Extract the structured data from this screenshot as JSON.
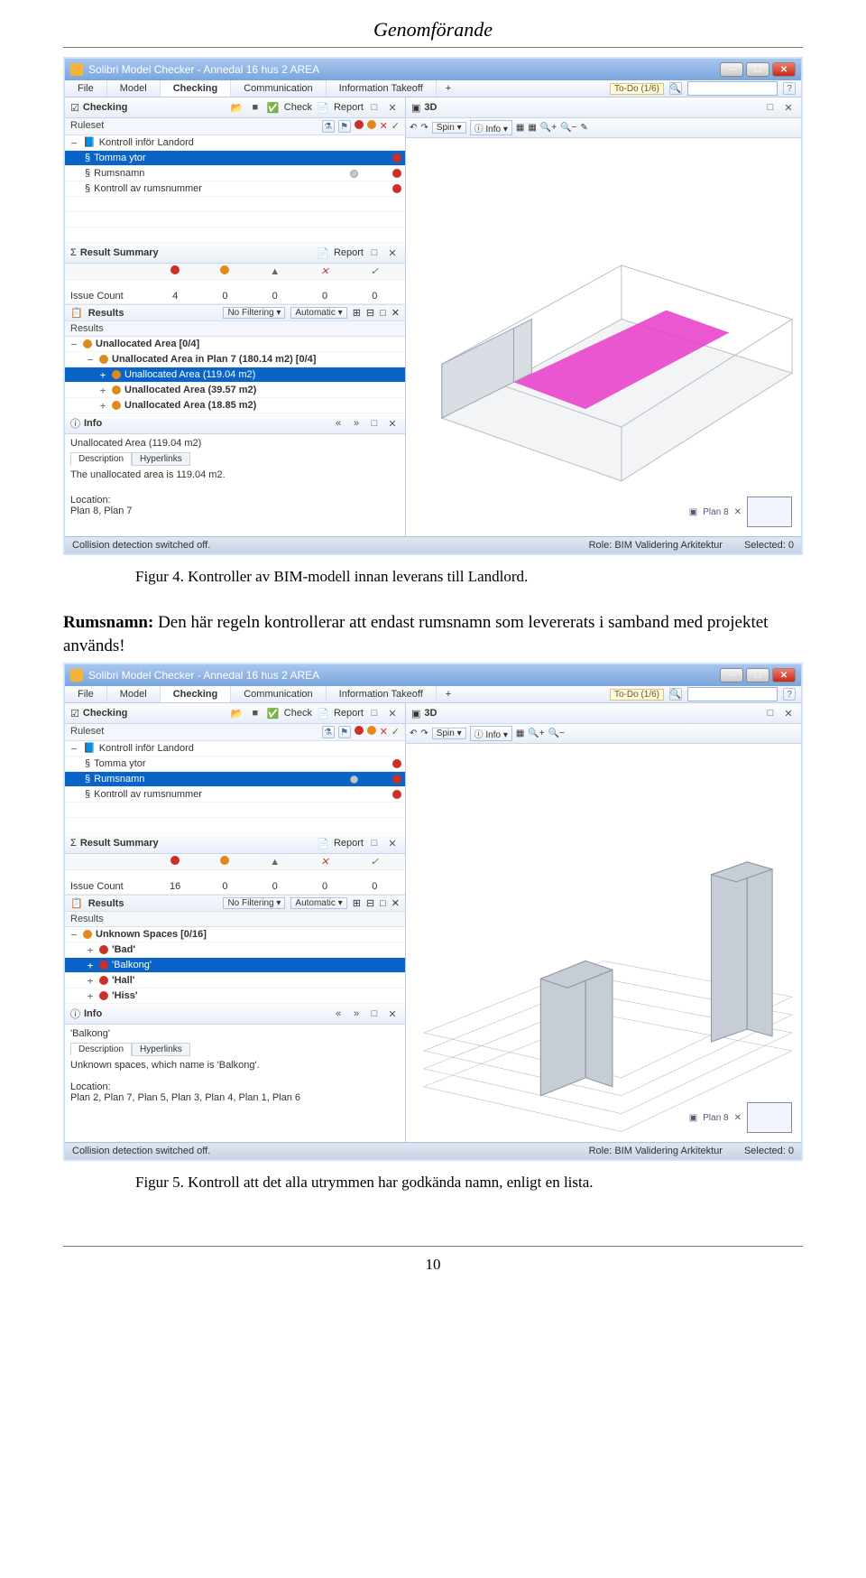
{
  "header": "Genomförande",
  "screenshot1": {
    "window_title": "Solibri Model Checker - Annedal 16 hus 2 AREA",
    "menus": [
      "File",
      "Model",
      "Checking",
      "Communication",
      "Information Takeoff"
    ],
    "active_menu": "Checking",
    "todo": "To-Do (1/6)",
    "checking_panel_title": "Checking",
    "check_btn": "Check",
    "report_btn": "Report",
    "ruleset_label": "Ruleset",
    "ruleset_root": "Kontroll inför Landord",
    "rules": [
      {
        "name": "Tomma ytor",
        "sev": "red",
        "selected": true
      },
      {
        "name": "Rumsnamn",
        "sev": "red",
        "selected": false,
        "extra": "grey"
      },
      {
        "name": "Kontroll av rumsnummer",
        "sev": "red",
        "selected": false
      }
    ],
    "summary_title": "Result Summary",
    "summary_report_btn": "Report",
    "issue_count_label": "Issue Count",
    "summary_counts": [
      "4",
      "0",
      "0",
      "0",
      "0"
    ],
    "results_title": "Results",
    "no_filtering": "No Filtering",
    "automatic": "Automatic",
    "results_label": "Results",
    "results_tree": [
      {
        "text": "Unallocated Area [0/4]",
        "sev": "orange",
        "bold": true,
        "indent": 0,
        "exp": "−"
      },
      {
        "text": "Unallocated Area in Plan 7 (180.14 m2) [0/4]",
        "sev": "orange",
        "bold": true,
        "indent": 1,
        "exp": "−"
      },
      {
        "text": "Unallocated Area (119.04 m2)",
        "sev": "orange",
        "indent": 2,
        "exp": "+",
        "selected": true
      },
      {
        "text": "Unallocated Area (39.57 m2)",
        "sev": "orange",
        "indent": 2,
        "exp": "+",
        "bold": true
      },
      {
        "text": "Unallocated Area (18.85 m2)",
        "sev": "orange",
        "indent": 2,
        "exp": "+",
        "bold": true
      }
    ],
    "info_title": "Info",
    "info_item": "Unallocated Area (119.04 m2)",
    "tab_desc": "Description",
    "tab_links": "Hyperlinks",
    "info_desc": "The unallocated area is 119.04 m2.",
    "loc_label": "Location:",
    "loc_value": "Plan 8, Plan 7",
    "view3d_title": "3D",
    "spin": "Spin",
    "info": "Info",
    "floor_tag": "Plan 8",
    "status_left": "Collision detection switched off.",
    "status_role": "Role: BIM Validering Arkitektur",
    "status_sel": "Selected: 0"
  },
  "caption1": "Figur 4. Kontroller av BIM-modell innan leverans till Landlord.",
  "paragraph_label": "Rumsnamn:",
  "paragraph_text": " Den här regeln kontrollerar att endast rumsnamn som levererats i samband med projektet används!",
  "screenshot2": {
    "window_title": "Solibri Model Checker - Annedal 16 hus 2 AREA",
    "menus": [
      "File",
      "Model",
      "Checking",
      "Communication",
      "Information Takeoff"
    ],
    "active_menu": "Checking",
    "todo": "To-Do (1/6)",
    "checking_panel_title": "Checking",
    "check_btn": "Check",
    "report_btn": "Report",
    "ruleset_label": "Ruleset",
    "ruleset_root": "Kontroll inför Landord",
    "rules": [
      {
        "name": "Tomma ytor",
        "sev": "red",
        "selected": false
      },
      {
        "name": "Rumsnamn",
        "sev": "red",
        "selected": true,
        "extra": "grey"
      },
      {
        "name": "Kontroll av rumsnummer",
        "sev": "red",
        "selected": false
      }
    ],
    "summary_title": "Result Summary",
    "summary_report_btn": "Report",
    "issue_count_label": "Issue Count",
    "summary_counts": [
      "16",
      "0",
      "0",
      "0",
      "0"
    ],
    "results_title": "Results",
    "no_filtering": "No Filtering",
    "automatic": "Automatic",
    "results_label": "Results",
    "results_tree": [
      {
        "text": "Unknown Spaces [0/16]",
        "sev": "orange",
        "bold": true,
        "indent": 0,
        "exp": "−"
      },
      {
        "text": "'Bad'",
        "sev": "red",
        "indent": 1,
        "exp": "+",
        "bold": true
      },
      {
        "text": "'Balkong'",
        "sev": "red",
        "indent": 1,
        "exp": "+",
        "selected": true
      },
      {
        "text": "'Hall'",
        "sev": "red",
        "indent": 1,
        "exp": "+",
        "bold": true
      },
      {
        "text": "'Hiss'",
        "sev": "red",
        "indent": 1,
        "exp": "+",
        "bold": true
      }
    ],
    "info_title": "Info",
    "info_item": "'Balkong'",
    "tab_desc": "Description",
    "tab_links": "Hyperlinks",
    "info_desc": "Unknown spaces, which name is 'Balkong'.",
    "loc_label": "Location:",
    "loc_value": "Plan 2, Plan 7, Plan 5, Plan 3, Plan 4, Plan 1, Plan 6",
    "view3d_title": "3D",
    "spin": "Spin",
    "info": "Info",
    "floor_tag": "Plan 8",
    "status_left": "Collision detection switched off.",
    "status_role": "Role: BIM Validering Arkitektur",
    "status_sel": "Selected: 0"
  },
  "caption2": "Figur 5. Kontroll att det alla utrymmen har godkända namn, enligt en lista.",
  "page_number": "10"
}
